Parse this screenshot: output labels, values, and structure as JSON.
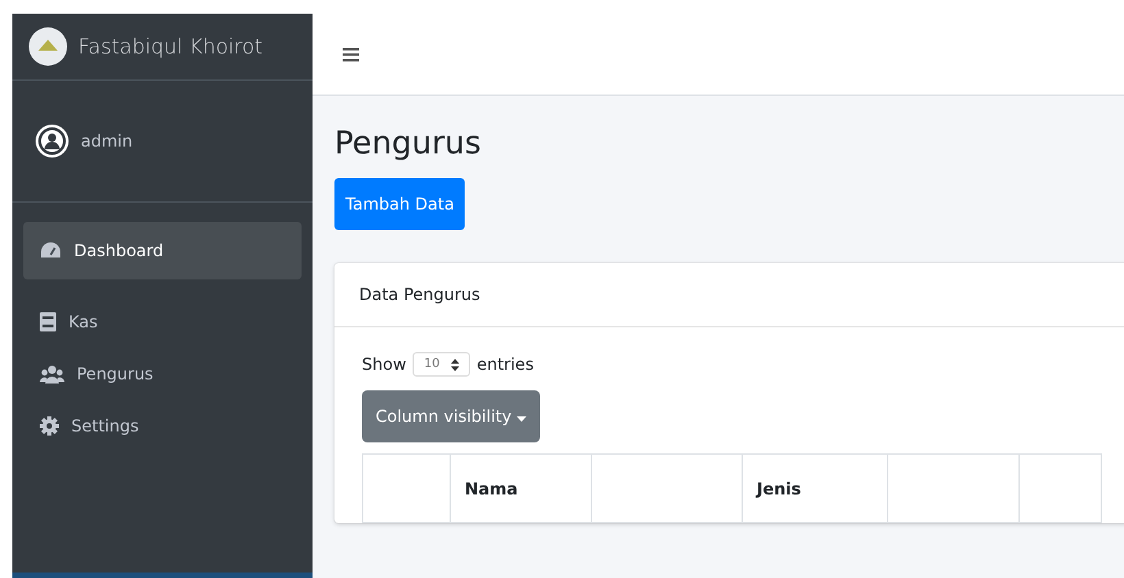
{
  "sidebar": {
    "brand": "Fastabiqul Khoirot",
    "user": "admin",
    "items": [
      {
        "label": "Dashboard",
        "selected": true
      },
      {
        "label": "Kas",
        "selected": false
      },
      {
        "label": "Pengurus",
        "selected": false
      },
      {
        "label": "Settings",
        "selected": false
      }
    ]
  },
  "page": {
    "title": "Pengurus",
    "add_button": "Tambah Data"
  },
  "card": {
    "title": "Data Pengurus",
    "show_label": "Show",
    "page_size": "10",
    "entries_label": "entries",
    "column_visibility": "Column visibility",
    "columns": [
      {},
      {
        "label": "Nama"
      },
      {},
      {
        "label": "Jenis"
      },
      {},
      {}
    ]
  }
}
